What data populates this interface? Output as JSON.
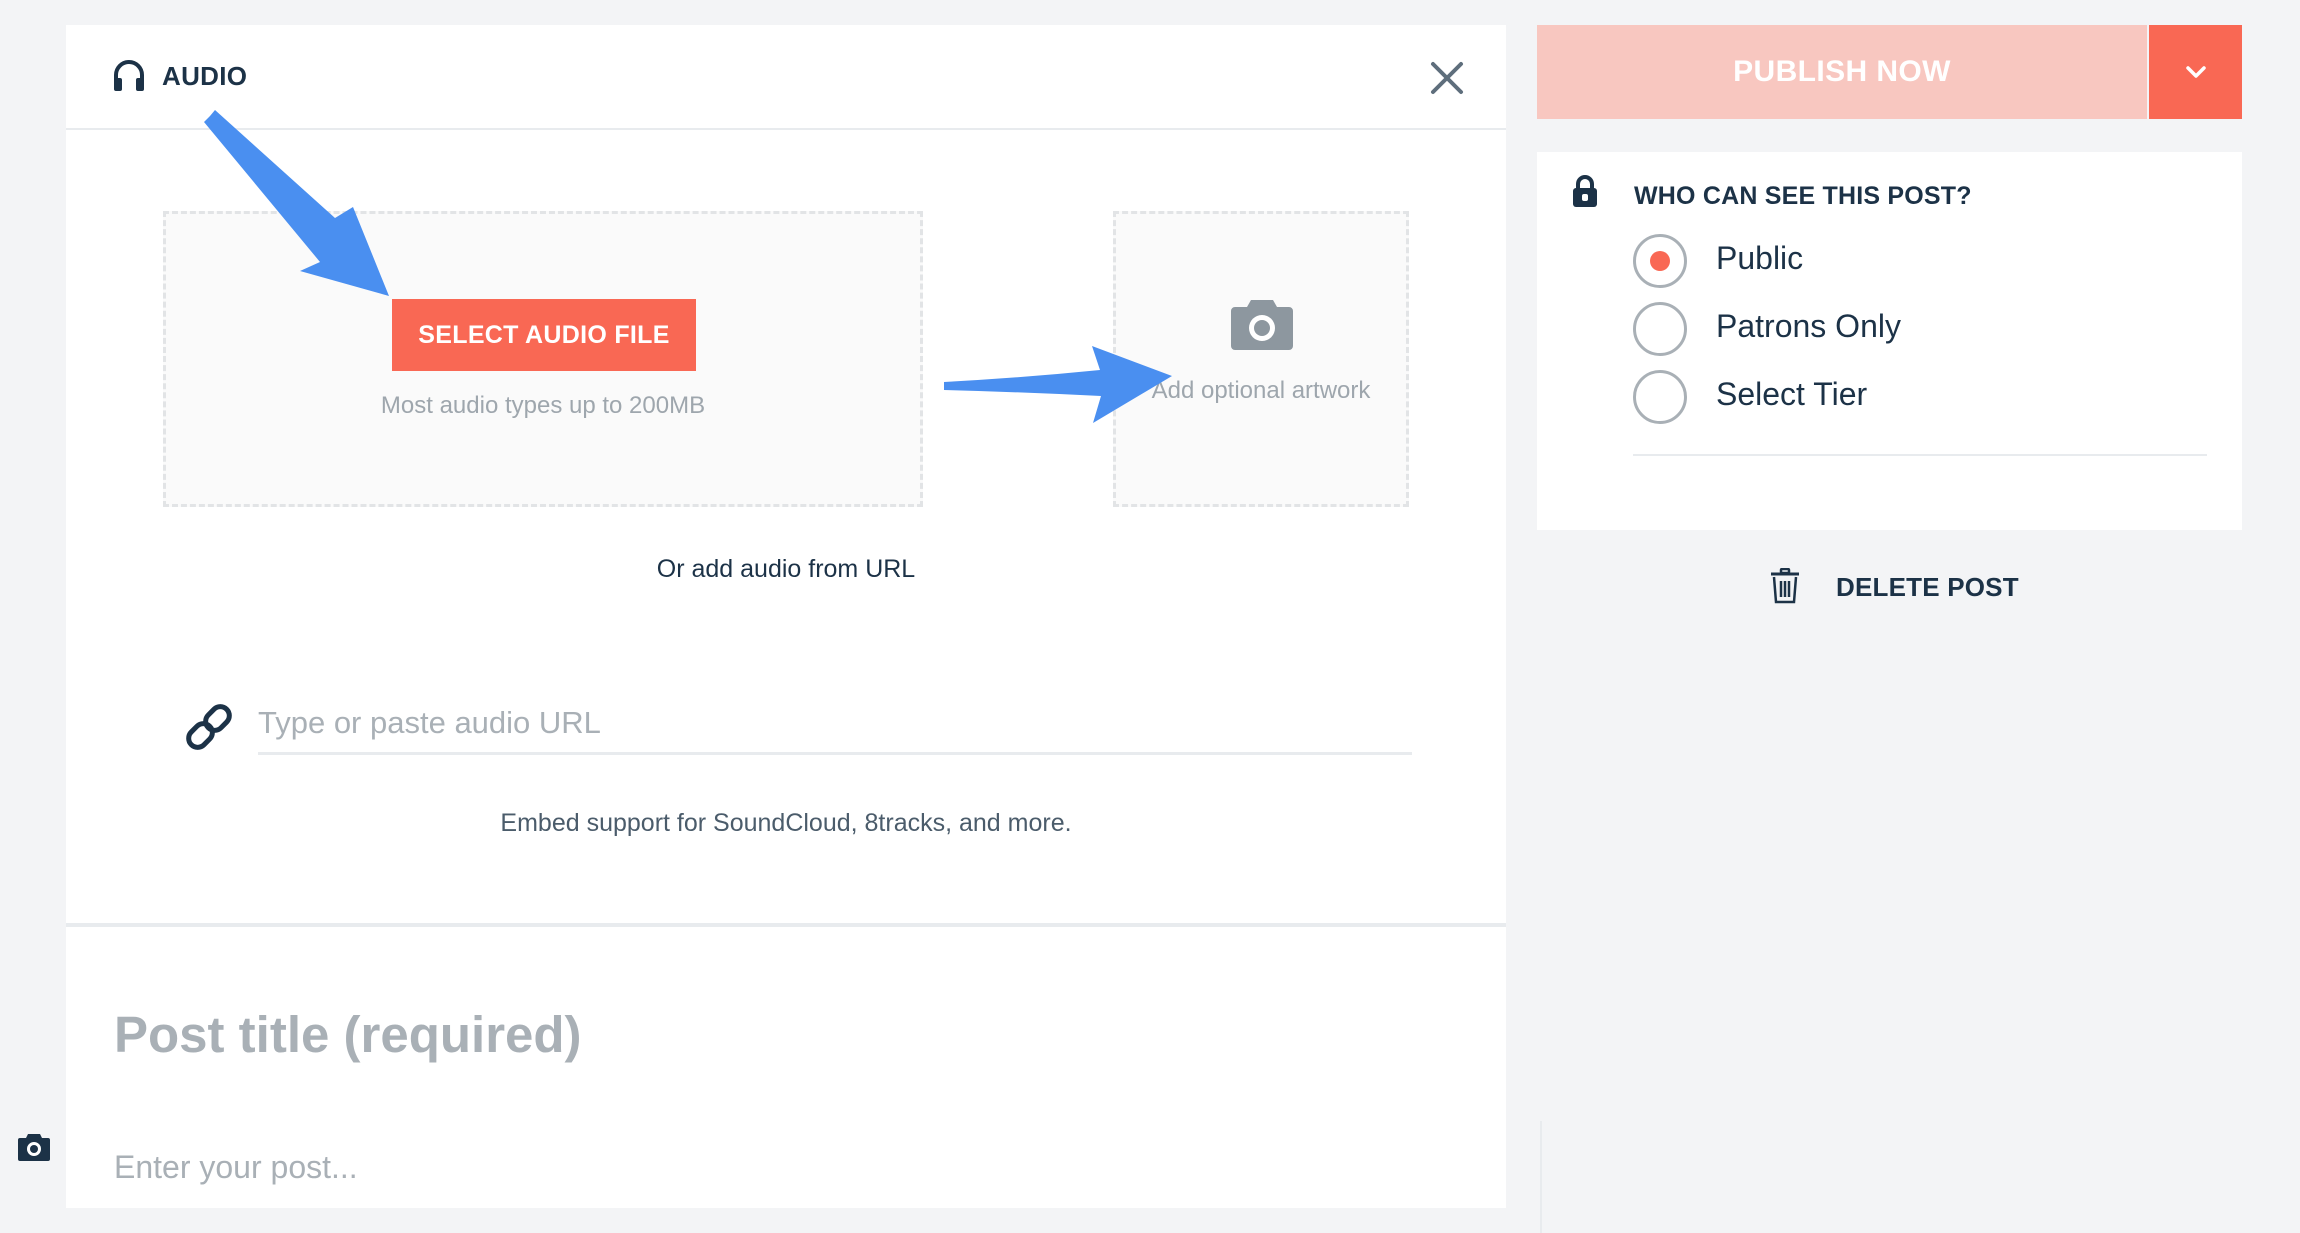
{
  "audio_panel": {
    "title": "AUDIO",
    "header_icon": "headphones-icon",
    "close_icon": "close-icon",
    "select_button_label": "SELECT AUDIO FILE",
    "dropzone_hint": "Most audio types up to 200MB",
    "artwork_icon": "camera-icon",
    "artwork_label": "Add optional artwork",
    "or_url_text": "Or add audio from URL",
    "url_icon": "link-icon",
    "url_placeholder": "Type or paste audio URL",
    "embed_note": "Embed support for SoundCloud, 8tracks, and more."
  },
  "post": {
    "title_placeholder": "Post title (required)",
    "body_placeholder": "Enter your post...",
    "side_icon": "camera-icon"
  },
  "publish": {
    "label": "PUBLISH NOW",
    "dropdown_icon": "chevron-down-icon"
  },
  "visibility": {
    "icon": "lock-icon",
    "title": "WHO CAN SEE THIS POST?",
    "options": [
      {
        "label": "Public",
        "selected": true
      },
      {
        "label": "Patrons Only",
        "selected": false
      },
      {
        "label": "Select Tier",
        "selected": false
      }
    ]
  },
  "delete": {
    "label": "DELETE POST",
    "icon": "trash-icon"
  },
  "colors": {
    "accent": "#f96854",
    "accent_light": "#f8c7c0",
    "text_dark": "#1c3247",
    "muted": "#a9b0b6",
    "annotation_arrow": "#4a8ff0"
  }
}
